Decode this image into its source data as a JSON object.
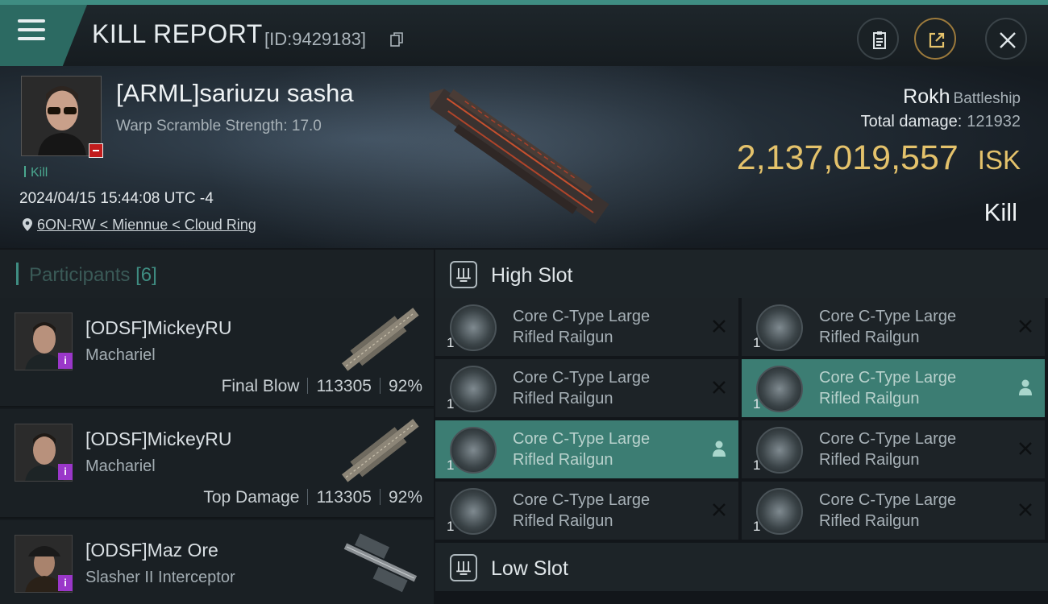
{
  "header": {
    "title": "KILL REPORT",
    "id_text": "[ID:9429183]"
  },
  "victim": {
    "name": "[ARML]sariuzu sasha",
    "subtitle": "Warp Scramble Strength: 17.0",
    "kill_tag": "Kill",
    "datetime": "2024/04/15 15:44:08 UTC -4",
    "location": "6ON-RW < Miennue < Cloud Ring",
    "ship": "Rokh",
    "ship_class": "Battleship",
    "total_damage_label": "Total damage:",
    "total_damage": "121932",
    "isk_value": "2,137,019,557",
    "isk_unit": "ISK",
    "result": "Kill"
  },
  "participants": {
    "label": "Participants",
    "count": "[6]",
    "items": [
      {
        "name": "[ODSF]MickeyRU",
        "ship": "Machariel",
        "role": "Final Blow",
        "damage": "113305",
        "percent": "92%"
      },
      {
        "name": "[ODSF]MickeyRU",
        "ship": "Machariel",
        "role": "Top Damage",
        "damage": "113305",
        "percent": "92%"
      },
      {
        "name": "[ODSF]Maz Ore",
        "ship": "Slasher II Interceptor"
      }
    ]
  },
  "slots": {
    "high": {
      "label": "High Slot",
      "modules": [
        {
          "line1": "Core C-Type Large",
          "line2": "Rifled Railgun",
          "qty": "1",
          "state": "destroyed"
        },
        {
          "line1": "Core C-Type Large",
          "line2": "Rifled Railgun",
          "qty": "1",
          "state": "destroyed"
        },
        {
          "line1": "Core C-Type Large",
          "line2": "Rifled Railgun",
          "qty": "1",
          "state": "destroyed"
        },
        {
          "line1": "Core C-Type Large",
          "line2": "Rifled Railgun",
          "qty": "1",
          "state": "dropped"
        },
        {
          "line1": "Core C-Type Large",
          "line2": "Rifled Railgun",
          "qty": "1",
          "state": "dropped"
        },
        {
          "line1": "Core C-Type Large",
          "line2": "Rifled Railgun",
          "qty": "1",
          "state": "destroyed"
        },
        {
          "line1": "Core C-Type Large",
          "line2": "Rifled Railgun",
          "qty": "1",
          "state": "destroyed"
        },
        {
          "line1": "Core C-Type Large",
          "line2": "Rifled Railgun",
          "qty": "1",
          "state": "destroyed"
        }
      ]
    },
    "low": {
      "label": "Low Slot"
    }
  },
  "colors": {
    "accent": "#3f8d82",
    "isk_gold": "#e4c26b",
    "badge_purple": "#9a37c9",
    "badge_red": "#c21c1c"
  }
}
